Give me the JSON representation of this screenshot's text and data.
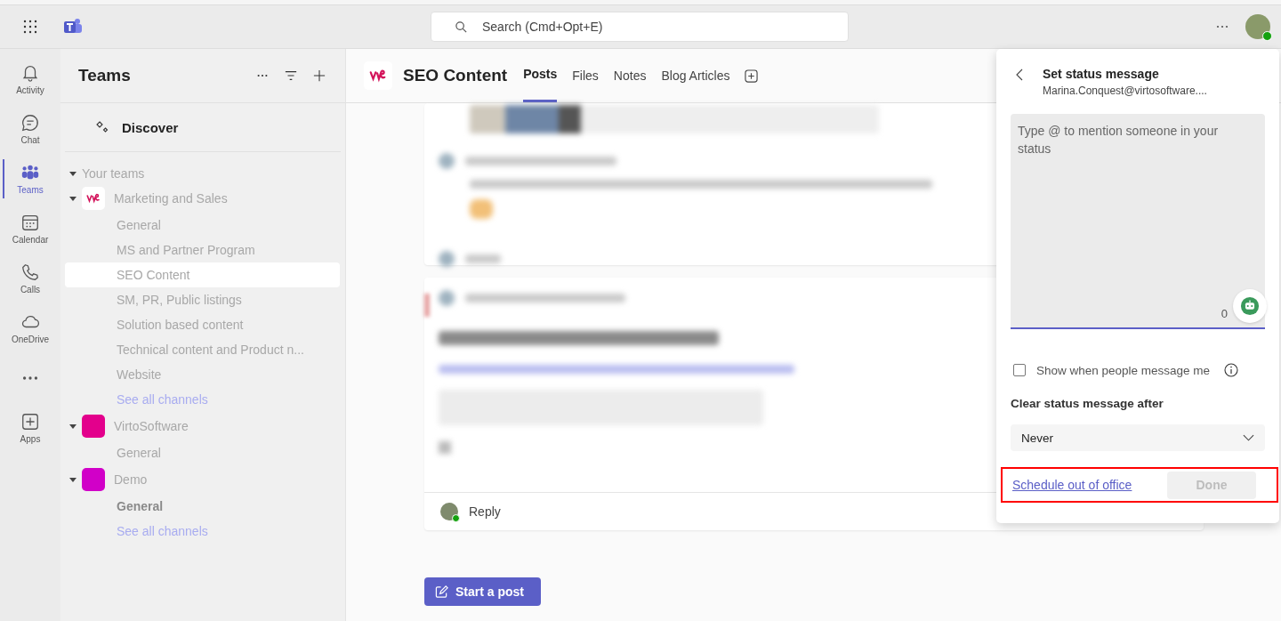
{
  "search": {
    "placeholder": "Search (Cmd+Opt+E)"
  },
  "rail": [
    {
      "label": "Activity",
      "kind": "bell",
      "selected": false
    },
    {
      "label": "Chat",
      "kind": "chat",
      "selected": false
    },
    {
      "label": "Teams",
      "kind": "teams",
      "selected": true
    },
    {
      "label": "Calendar",
      "kind": "calendar",
      "selected": false
    },
    {
      "label": "Calls",
      "kind": "calls",
      "selected": false
    },
    {
      "label": "OneDrive",
      "kind": "cloud",
      "selected": false
    },
    {
      "kind": "more",
      "selected": false
    },
    {
      "label": "Apps",
      "kind": "apps",
      "selected": false
    }
  ],
  "sidebar": {
    "title": "Teams",
    "discover": "Discover",
    "section": "Your teams",
    "teams": [
      {
        "name": "Marketing and Sales",
        "color": "#ffffff",
        "expanded": true,
        "channels": [
          {
            "name": "General",
            "selected": false,
            "unread": false
          },
          {
            "name": "MS and Partner Program",
            "selected": false,
            "unread": false
          },
          {
            "name": "SEO Content",
            "selected": true,
            "unread": false
          },
          {
            "name": "SM, PR, Public listings",
            "selected": false,
            "unread": false
          },
          {
            "name": "Solution based content",
            "selected": false,
            "unread": false
          },
          {
            "name": "Technical content and Product n...",
            "selected": false,
            "unread": false
          },
          {
            "name": "Website",
            "selected": false,
            "unread": false
          }
        ],
        "see_all": "See all channels"
      },
      {
        "name": "VirtoSoftware",
        "color": "#e3008c",
        "expanded": true,
        "channels": [
          {
            "name": "General",
            "selected": false,
            "unread": false
          }
        ]
      },
      {
        "name": "Demo",
        "color": "#d100c8",
        "expanded": true,
        "channels": [
          {
            "name": "General",
            "selected": false,
            "unread": true
          }
        ],
        "see_all": "See all channels"
      }
    ]
  },
  "channel": {
    "title": "SEO Content",
    "tabs": [
      {
        "label": "Posts",
        "selected": true
      },
      {
        "label": "Files",
        "selected": false
      },
      {
        "label": "Notes",
        "selected": false
      },
      {
        "label": "Blog Articles",
        "selected": false
      }
    ]
  },
  "reply": "Reply",
  "start_post": "Start a post",
  "status_panel": {
    "title": "Set status message",
    "account": "Marina.Conquest@virtosoftware....",
    "placeholder": "Type @ to mention someone in your status",
    "counter": "0",
    "show_when_messaged": {
      "label": "Show when people message me",
      "checked": false
    },
    "clear_after_label": "Clear status message after",
    "clear_after": "Never",
    "schedule_link": "Schedule out of office",
    "done": {
      "label": "Done",
      "disabled": true
    }
  }
}
